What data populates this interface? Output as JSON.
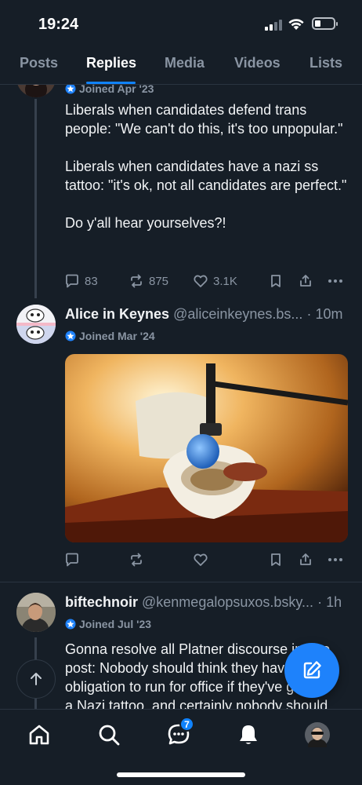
{
  "status_bar": {
    "time": "19:24"
  },
  "tabs": [
    {
      "label": "Posts"
    },
    {
      "label": "Replies"
    },
    {
      "label": "Media"
    },
    {
      "label": "Videos"
    },
    {
      "label": "Lists"
    }
  ],
  "active_tab": "Replies",
  "posts": [
    {
      "joined": "Joined Apr '23",
      "body": [
        "Liberals when candidates defend trans people: \"We can't do this, it's too unpopular.\"",
        "Liberals when candidates have a nazi ss tattoo: \"it's ok, not all candidates are perfect.\"",
        "Do y'all hear yourselves?!"
      ],
      "replies": "83",
      "reposts": "875",
      "likes": "3.1K"
    },
    {
      "display_name": "Alice in Keynes",
      "handle": "@aliceinkeynes.bs...",
      "time": "· 10m",
      "joined": "Joined Mar '24"
    },
    {
      "display_name": "biftechnoir",
      "handle": "@kenmegalopsuxos.bsky...",
      "time": "· 1h",
      "joined": "Joined Jul '23",
      "body_lines": [
        "Gonna resolve all Platner discourse in one",
        "post: Nobody should think they have",
        "obligation to run for office if they've got",
        "a Nazi tattoo, and certainly nobody should"
      ]
    }
  ],
  "nav": {
    "notifications_badge": "7"
  },
  "colors": {
    "accent": "#1083fe",
    "background": "#161e27",
    "muted": "#8a95a3"
  }
}
